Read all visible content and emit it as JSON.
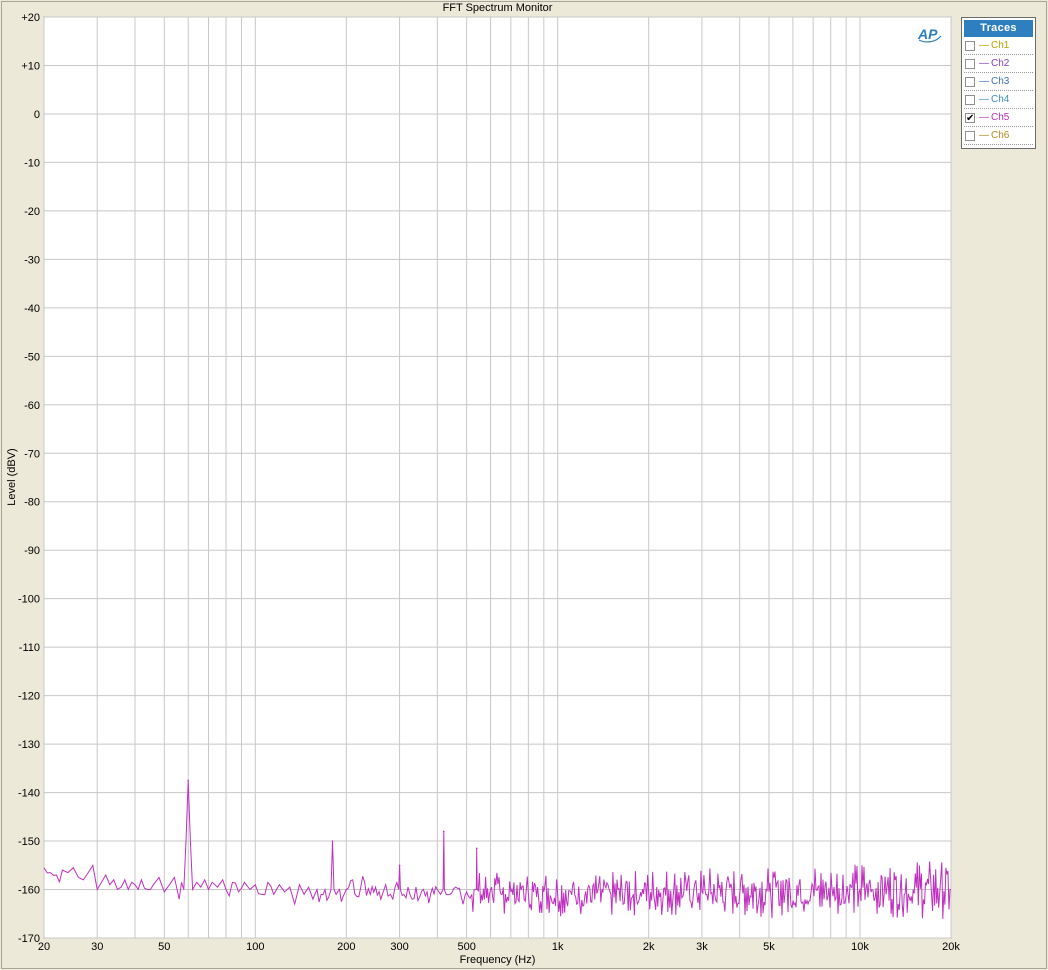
{
  "window": {
    "title": "FFT Spectrum Monitor"
  },
  "traces_panel": {
    "header": "Traces",
    "items": [
      {
        "label": "Ch1",
        "checked": false,
        "color": "#b8a000"
      },
      {
        "label": "Ch2",
        "checked": false,
        "color": "#8a3fc0"
      },
      {
        "label": "Ch3",
        "checked": false,
        "color": "#3f6fb8"
      },
      {
        "label": "Ch4",
        "checked": false,
        "color": "#3f8fc0"
      },
      {
        "label": "Ch5",
        "checked": true,
        "color": "#c030c0"
      },
      {
        "label": "Ch6",
        "checked": false,
        "color": "#b08a20"
      }
    ],
    "check_mark": "✔",
    "line_glyph": "—"
  },
  "logo": {
    "text": "AP",
    "color": "#2e7fbf"
  },
  "chart_data": {
    "type": "line",
    "xlabel": "Frequency (Hz)",
    "ylabel": "Level (dBV)",
    "xscale": "log",
    "xlim": [
      20,
      20000
    ],
    "ylim": [
      -170,
      20
    ],
    "grid": true,
    "legend_placement": "top-right (outside plot)",
    "x_ticks": [
      {
        "v": 20,
        "label": "20"
      },
      {
        "v": 30,
        "label": "30"
      },
      {
        "v": 50,
        "label": "50"
      },
      {
        "v": 100,
        "label": "100"
      },
      {
        "v": 200,
        "label": "200"
      },
      {
        "v": 300,
        "label": "300"
      },
      {
        "v": 500,
        "label": "500"
      },
      {
        "v": 1000,
        "label": "1k"
      },
      {
        "v": 2000,
        "label": "2k"
      },
      {
        "v": 3000,
        "label": "3k"
      },
      {
        "v": 5000,
        "label": "5k"
      },
      {
        "v": 10000,
        "label": "10k"
      },
      {
        "v": 20000,
        "label": "20k"
      }
    ],
    "y_ticks": [
      {
        "v": 20,
        "label": "+20"
      },
      {
        "v": 10,
        "label": "+10"
      },
      {
        "v": 0,
        "label": "0"
      },
      {
        "v": -10,
        "label": "-10"
      },
      {
        "v": -20,
        "label": "-20"
      },
      {
        "v": -30,
        "label": "-30"
      },
      {
        "v": -40,
        "label": "-40"
      },
      {
        "v": -50,
        "label": "-50"
      },
      {
        "v": -60,
        "label": "-60"
      },
      {
        "v": -70,
        "label": "-70"
      },
      {
        "v": -80,
        "label": "-80"
      },
      {
        "v": -90,
        "label": "-90"
      },
      {
        "v": -100,
        "label": "-100"
      },
      {
        "v": -110,
        "label": "-110"
      },
      {
        "v": -120,
        "label": "-120"
      },
      {
        "v": -130,
        "label": "-130"
      },
      {
        "v": -140,
        "label": "-140"
      },
      {
        "v": -150,
        "label": "-150"
      },
      {
        "v": -160,
        "label": "-160"
      },
      {
        "v": -170,
        "label": "-170"
      }
    ],
    "series": [
      {
        "name": "Ch5",
        "color": "#c030c0",
        "noise_floor_dbv": -159,
        "peaks": [
          {
            "x": 60,
            "y": -137.5
          },
          {
            "x": 180,
            "y": -150
          },
          {
            "x": 300,
            "y": -155
          },
          {
            "x": 420,
            "y": -148
          },
          {
            "x": 540,
            "y": -151.5
          }
        ],
        "points": [
          [
            20,
            -155.5
          ],
          [
            21,
            -156.5
          ],
          [
            22,
            -157
          ],
          [
            23,
            -156
          ],
          [
            24,
            -156.5
          ],
          [
            25,
            -155.5
          ],
          [
            26,
            -157.5
          ],
          [
            27,
            -158
          ],
          [
            28,
            -156.5
          ],
          [
            29,
            -155
          ],
          [
            30,
            -160
          ],
          [
            31,
            -158.5
          ],
          [
            32,
            -157
          ],
          [
            33,
            -159
          ],
          [
            34,
            -158
          ],
          [
            35,
            -160
          ],
          [
            36,
            -159.5
          ],
          [
            37,
            -158
          ],
          [
            38,
            -160
          ],
          [
            39,
            -158.5
          ],
          [
            40,
            -159
          ],
          [
            42,
            -158
          ],
          [
            44,
            -160
          ],
          [
            46,
            -159
          ],
          [
            48,
            -157.5
          ],
          [
            50,
            -160.5
          ],
          [
            52,
            -159
          ],
          [
            54,
            -157.5
          ],
          [
            56,
            -162
          ],
          [
            57,
            -158.5
          ],
          [
            58,
            -160
          ],
          [
            59,
            -150
          ],
          [
            60,
            -137.5
          ],
          [
            61,
            -150
          ],
          [
            62,
            -160
          ],
          [
            64,
            -158.5
          ],
          [
            66,
            -159.5
          ],
          [
            68,
            -158
          ],
          [
            70,
            -160
          ],
          [
            72,
            -158.5
          ],
          [
            75,
            -159.5
          ],
          [
            78,
            -158
          ],
          [
            80,
            -160
          ],
          [
            84,
            -158.5
          ],
          [
            88,
            -160.5
          ],
          [
            92,
            -158.5
          ],
          [
            96,
            -160
          ],
          [
            100,
            -159
          ],
          [
            105,
            -161
          ],
          [
            110,
            -158.5
          ],
          [
            115,
            -161
          ],
          [
            120,
            -159
          ],
          [
            125,
            -160.5
          ],
          [
            130,
            -159.5
          ],
          [
            135,
            -163
          ],
          [
            140,
            -159
          ],
          [
            145,
            -161
          ],
          [
            150,
            -159.5
          ],
          [
            155,
            -162
          ],
          [
            160,
            -160
          ],
          [
            165,
            -161
          ],
          [
            170,
            -160
          ],
          [
            175,
            -161.5
          ],
          [
            178,
            -160
          ],
          [
            180,
            -150
          ],
          [
            182,
            -160
          ],
          [
            185,
            -161
          ],
          [
            190,
            -160
          ],
          [
            195,
            -161.5
          ],
          [
            200,
            -160
          ],
          [
            210,
            -158
          ],
          [
            220,
            -161.5
          ],
          [
            230,
            -158.5
          ],
          [
            240,
            -161
          ],
          [
            250,
            -159.5
          ],
          [
            260,
            -162
          ],
          [
            270,
            -159
          ],
          [
            280,
            -161
          ],
          [
            290,
            -159.5
          ],
          [
            298,
            -160
          ],
          [
            300,
            -155
          ],
          [
            302,
            -160
          ],
          [
            310,
            -161
          ],
          [
            320,
            -159.5
          ],
          [
            330,
            -162
          ],
          [
            340,
            -159.5
          ],
          [
            350,
            -161.5
          ],
          [
            360,
            -160
          ],
          [
            380,
            -161
          ],
          [
            400,
            -160
          ],
          [
            410,
            -161
          ],
          [
            418,
            -160
          ],
          [
            420,
            -148
          ],
          [
            422,
            -160
          ],
          [
            440,
            -161
          ],
          [
            460,
            -159.5
          ],
          [
            480,
            -161.5
          ],
          [
            500,
            -160.5
          ],
          [
            520,
            -161
          ],
          [
            538,
            -160
          ],
          [
            540,
            -151.5
          ],
          [
            542,
            -160
          ],
          [
            560,
            -161
          ],
          [
            600,
            -160
          ],
          [
            650,
            -161
          ],
          [
            700,
            -160.5
          ],
          [
            800,
            -161
          ],
          [
            900,
            -160.5
          ],
          [
            1000,
            -161
          ],
          [
            1500,
            -161
          ],
          [
            2000,
            -160.5
          ],
          [
            3000,
            -160.5
          ],
          [
            5000,
            -160.5
          ],
          [
            10000,
            -160
          ],
          [
            15000,
            -160
          ],
          [
            20000,
            -160
          ]
        ]
      }
    ]
  }
}
